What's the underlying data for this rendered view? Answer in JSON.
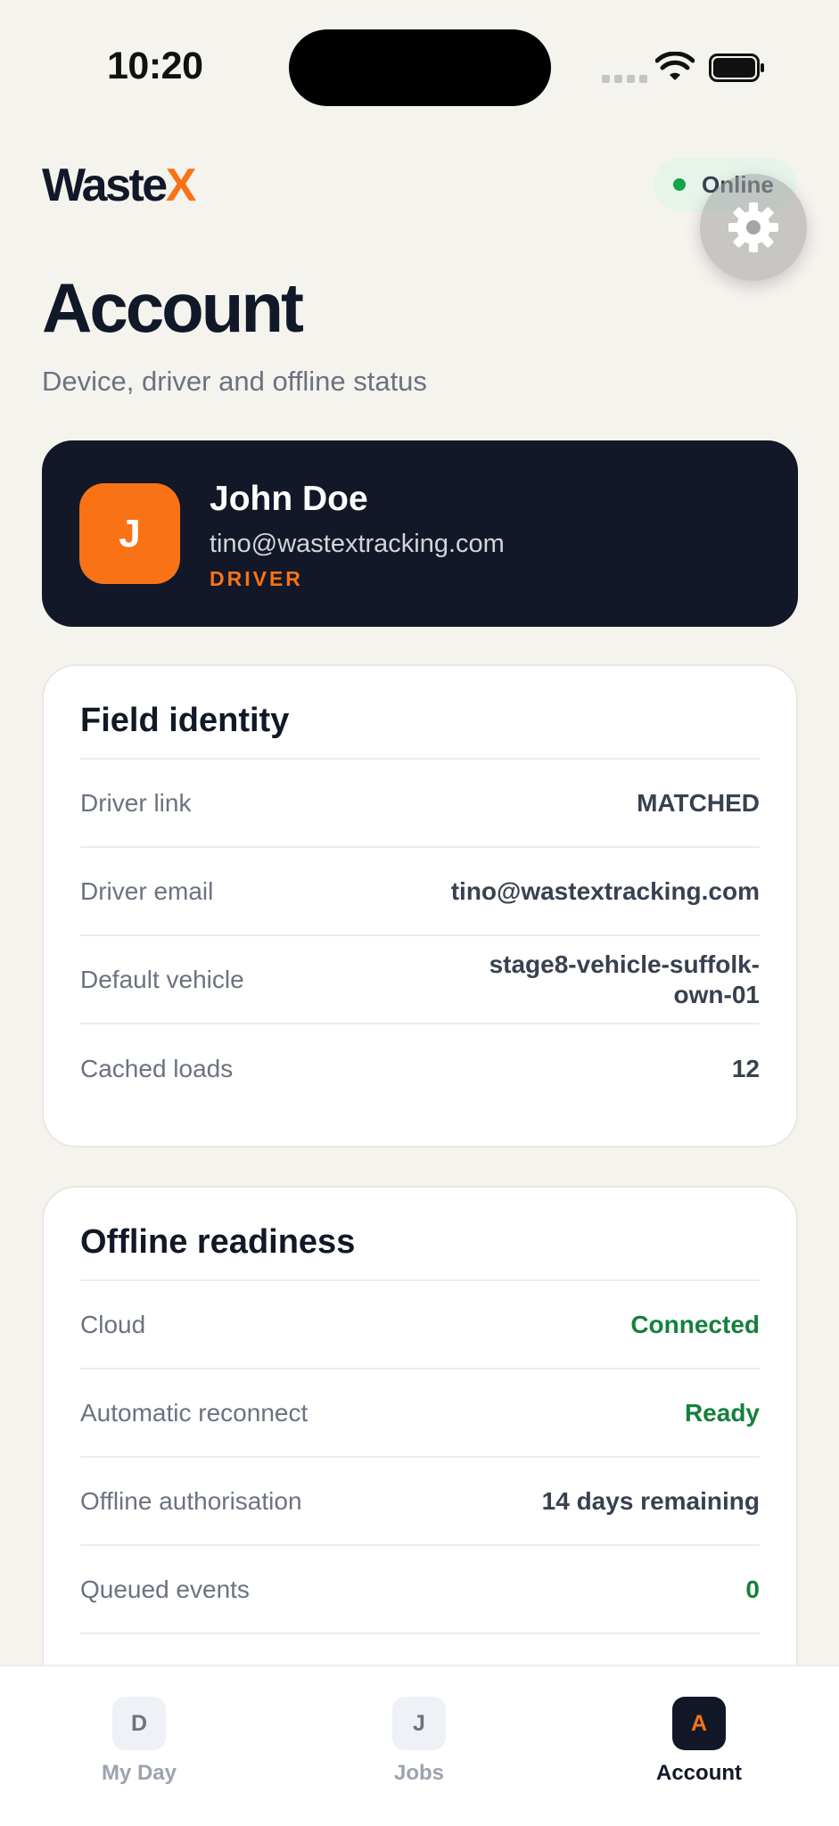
{
  "status_bar": {
    "time": "10:20"
  },
  "header": {
    "logo_main": "Waste",
    "logo_accent": "X",
    "status_label": "Online",
    "status_color": "#16a34a"
  },
  "page": {
    "title": "Account",
    "subtitle": "Device, driver and offline status"
  },
  "profile": {
    "avatar_initial": "J",
    "name": "John Doe",
    "email": "tino@wastextracking.com",
    "role": "DRIVER"
  },
  "field_identity": {
    "title": "Field identity",
    "rows": [
      {
        "label": "Driver link",
        "value": "MATCHED"
      },
      {
        "label": "Driver email",
        "value": "tino@wastextracking.com"
      },
      {
        "label": "Default vehicle",
        "value": "stage8-vehicle-suffolk-own-01"
      },
      {
        "label": "Cached loads",
        "value": "12"
      }
    ]
  },
  "offline_readiness": {
    "title": "Offline readiness",
    "rows": [
      {
        "label": "Cloud",
        "value": "Connected"
      },
      {
        "label": "Automatic reconnect",
        "value": "Ready"
      },
      {
        "label": "Offline authorisation",
        "value": "14 days remaining"
      },
      {
        "label": "Queued events",
        "value": "0"
      }
    ]
  },
  "colors": {
    "accent": "#f97316",
    "dark": "#121827",
    "success": "#15803d",
    "background": "#f5f3ee"
  },
  "tabs": [
    {
      "icon": "D",
      "label": "My Day"
    },
    {
      "icon": "J",
      "label": "Jobs"
    },
    {
      "icon": "A",
      "label": "Account"
    }
  ]
}
